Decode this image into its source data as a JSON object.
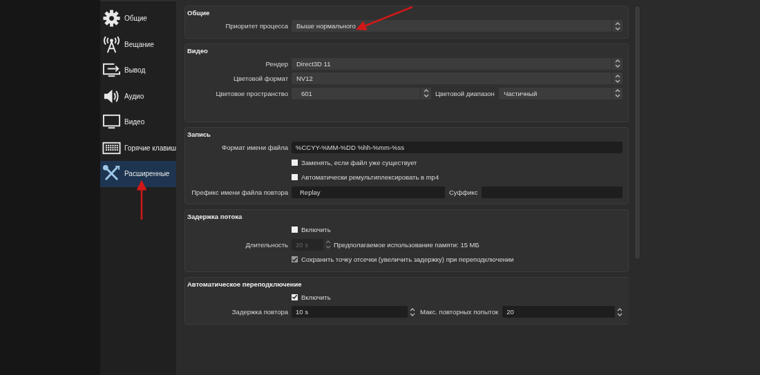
{
  "sidebar": {
    "items": [
      {
        "label": "Общие",
        "selected": false
      },
      {
        "label": "Вещание",
        "selected": false
      },
      {
        "label": "Вывод",
        "selected": false
      },
      {
        "label": "Аудио",
        "selected": false
      },
      {
        "label": "Видео",
        "selected": false
      },
      {
        "label": "Горячие клавиш",
        "selected": false
      },
      {
        "label": "Расширенные",
        "selected": true
      }
    ]
  },
  "sections": [
    {
      "title": "Общие",
      "rows": [
        {
          "kind": "select",
          "label": "Приоритет процесса",
          "value": "Выше нормального"
        }
      ]
    },
    {
      "title": "Видео",
      "rows": [
        {
          "kind": "select",
          "label": "Рендер",
          "value": "Direct3D 11"
        },
        {
          "kind": "select",
          "label": "Цветовой формат",
          "value": "NV12"
        },
        {
          "kind": "pair",
          "fields": [
            {
              "kind": "select",
              "label": "Цветовое пространство",
              "value": "601"
            },
            {
              "kind": "select",
              "label": "Цветовой диапазон",
              "value": "Частичный"
            }
          ]
        }
      ]
    },
    {
      "title": "Запись",
      "rows": [
        {
          "kind": "text",
          "label": "Формат имени файла",
          "value": "%CCYY-%MM-%DD %hh-%mm-%ss"
        },
        {
          "kind": "checkbox",
          "label": "Заменять, если файл уже существует",
          "checked": false,
          "disabled": false
        },
        {
          "kind": "checkbox",
          "label": "Автоматически ремультиплексировать в mp4",
          "checked": false,
          "disabled": false
        },
        {
          "kind": "pair",
          "fields": [
            {
              "kind": "text",
              "label": "Префикс имени файла повтора",
              "value": "Replay"
            },
            {
              "kind": "text",
              "label": "Суффикс"
            }
          ]
        }
      ]
    },
    {
      "title": "Задержка потока",
      "rows": [
        {
          "kind": "checkbox",
          "label": "Включить",
          "checked": false,
          "disabled": false
        },
        {
          "kind": "spin",
          "label": "Длительность",
          "value": "20 s",
          "disabled": true,
          "note": "Предполагаемое использование памяти: 15 МБ"
        },
        {
          "kind": "checkbox",
          "label": "Сохранить точку отсечки (увеличить задержку) при переподключении",
          "checked": true,
          "disabled": true
        }
      ]
    },
    {
      "title": "Автоматическое переподключение",
      "rows": [
        {
          "kind": "checkbox",
          "label": "Включить",
          "checked": true,
          "disabled": false
        },
        {
          "kind": "pair",
          "fields": [
            {
              "kind": "spin",
              "label": "Задержка повтора",
              "value": "10 s"
            },
            {
              "kind": "spin",
              "label": "Макс. повторных попыток",
              "value": "20"
            }
          ]
        }
      ]
    }
  ]
}
